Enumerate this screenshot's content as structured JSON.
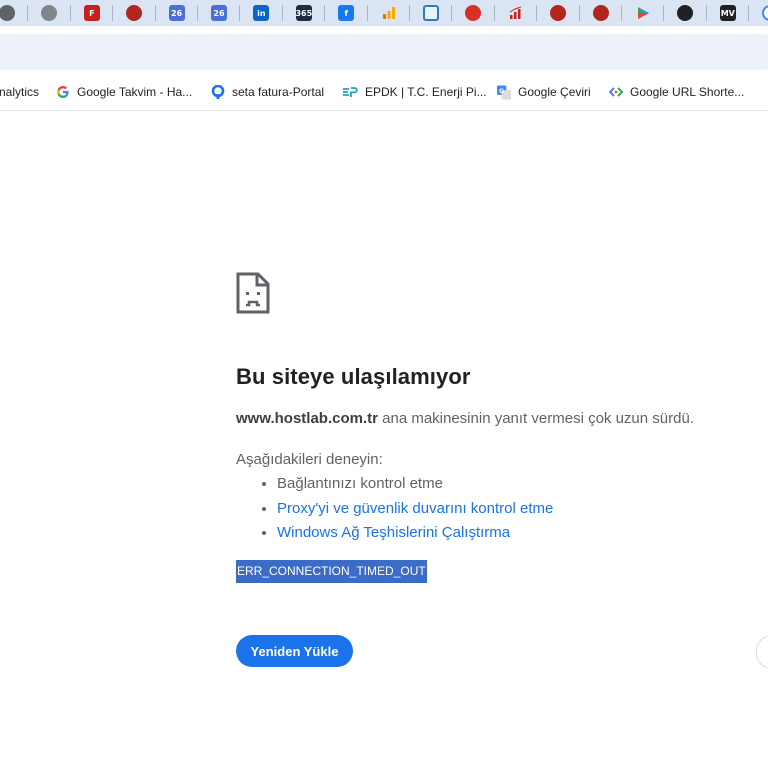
{
  "tabs": [
    {
      "icon": "chrome-icon",
      "color": "#5f6368"
    },
    {
      "icon": "globe-icon",
      "color": "#80868b"
    },
    {
      "icon": "f-letter-icon",
      "color": "#c5221f",
      "text": "F"
    },
    {
      "icon": "red-badge-icon",
      "color": "#b3261e"
    },
    {
      "icon": "calendar-26-icon",
      "color": "#4a6fd8",
      "text": "26"
    },
    {
      "icon": "calendar-26-icon",
      "color": "#4a6fd8",
      "text": "26"
    },
    {
      "icon": "linkedin-icon",
      "color": "#0a66c2",
      "text": "in"
    },
    {
      "icon": "365-icon",
      "color": "#1f2a44",
      "text": "365"
    },
    {
      "icon": "facebook-icon",
      "color": "#1877f2",
      "text": "f"
    },
    {
      "icon": "analytics-icon",
      "color": "#f9ab00"
    },
    {
      "icon": "portal-icon",
      "color": "#2f7ab8"
    },
    {
      "icon": "red-circle-icon",
      "color": "#d93025"
    },
    {
      "icon": "chart-icon",
      "color": "#c5221f"
    },
    {
      "icon": "tcmb-icon",
      "color": "#b3261e"
    },
    {
      "icon": "tcmb-icon",
      "color": "#b3261e"
    },
    {
      "icon": "play-icon",
      "color": "#4285f4"
    },
    {
      "icon": "camera-icon",
      "color": "#202124"
    },
    {
      "icon": "mv-icon",
      "color": "#202124",
      "text": "MV"
    },
    {
      "icon": "google-icon",
      "color": "#4285f4"
    }
  ],
  "bookmarks": [
    {
      "label": "nalytics",
      "icon": "analytics-icon",
      "icon_color": "#f9ab00"
    },
    {
      "label": "Google Takvim - Ha...",
      "icon": "google-g-icon",
      "icon_color": "#4285f4"
    },
    {
      "label": "seta fatura-Portal",
      "icon": "seta-portal-icon",
      "icon_color": "#1a73e8"
    },
    {
      "label": "EPDK | T.C. Enerji Pi...",
      "icon": "epdk-icon",
      "icon_color": "#1aa6b7"
    },
    {
      "label": "Google Çeviri",
      "icon": "google-translate-icon",
      "icon_color": "#4285f4"
    },
    {
      "label": "Google URL Shorte...",
      "icon": "url-shortener-icon",
      "icon_color": "#4285f4"
    }
  ],
  "error": {
    "title": "Bu siteye ulaşılamıyor",
    "host": "www.hostlab.com.tr",
    "message": " ana makinesinin yanıt vermesi çok uzun sürdü.",
    "suggest_heading": "Aşağıdakileri deneyin:",
    "suggestions": [
      {
        "text": "Bağlantınızı kontrol etme",
        "link": false
      },
      {
        "text": "Proxy'yi ve güvenlik duvarını kontrol etme",
        "link": true
      },
      {
        "text": "Windows Ağ Teşhislerini Çalıştırma",
        "link": true
      }
    ],
    "code": "ERR_CONNECTION_TIMED_OUT",
    "reload_label": "Yeniden Yükle"
  }
}
